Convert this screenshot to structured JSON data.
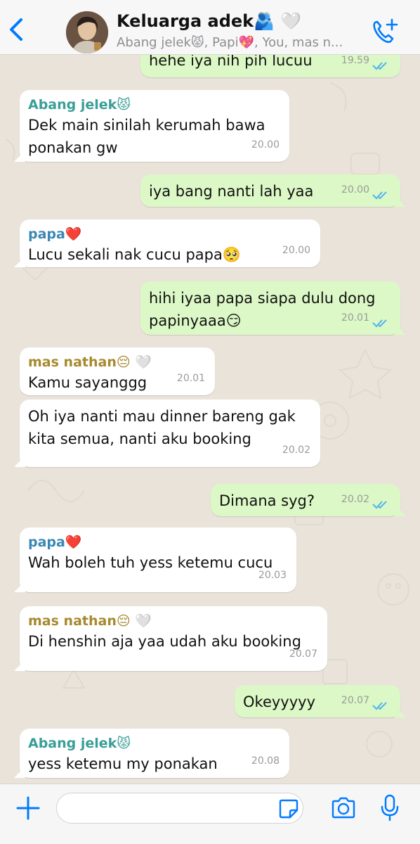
{
  "header": {
    "title": "Keluarga adek🫂 🤍",
    "subtitle": "Abang jelek😾, Papi💖, You, mas n...",
    "back_icon": "chevron-left-icon",
    "call_icon": "add-call-icon"
  },
  "colors": {
    "accent": "#007aff",
    "outgoing_bubble": "#dcf8c6",
    "incoming_bubble": "#ffffff",
    "tick_blue": "#4fb6ec",
    "sender_abang": "#3a9e97",
    "sender_papa": "#3a87b5",
    "sender_nathan": "#a7892e"
  },
  "messages": [
    {
      "dir": "out",
      "text": "hehe iya nih pih lucuu",
      "time": "19.59",
      "read": true
    },
    {
      "dir": "in",
      "sender": "Abang jelek😾",
      "text": "Dek main sinilah kerumah bawa ponakan gw",
      "time": "20.00"
    },
    {
      "dir": "out",
      "text": "iya bang nanti lah yaa",
      "time": "20.00",
      "read": true
    },
    {
      "dir": "in",
      "sender": "papa❤️",
      "text": "Lucu sekali nak cucu papa🥺",
      "time": "20.00"
    },
    {
      "dir": "out",
      "text": "hihi iyaa papa siapa dulu dong papinyaaa😏",
      "time": "20.01",
      "read": true
    },
    {
      "dir": "in",
      "sender": "mas nathan😔 🤍",
      "text": "Kamu sayanggg",
      "time": "20.01"
    },
    {
      "dir": "in",
      "text": "Oh iya nanti mau dinner bareng gak kita semua, nanti aku booking",
      "time": "20.02"
    },
    {
      "dir": "out",
      "text": "Dimana syg?",
      "time": "20.02",
      "read": true
    },
    {
      "dir": "in",
      "sender": "papa❤️",
      "text": "Wah boleh tuh yess ketemu cucu",
      "time": "20.03"
    },
    {
      "dir": "in",
      "sender": "mas nathan😔 🤍",
      "text": "Di henshin aja yaa udah aku booking",
      "time": "20.07"
    },
    {
      "dir": "out",
      "text": "Okeyyyyy",
      "time": "20.07",
      "read": true
    },
    {
      "dir": "in",
      "sender": "Abang jelek😾",
      "text": "yess ketemu my ponakan",
      "time": "20.08"
    }
  ],
  "input_bar": {
    "placeholder": "",
    "icons": [
      "plus-icon",
      "sticker-icon",
      "camera-icon",
      "microphone-icon"
    ]
  }
}
